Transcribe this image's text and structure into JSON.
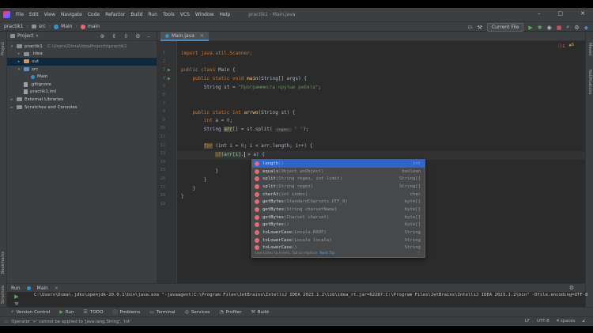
{
  "menubar": {
    "items": [
      "File",
      "Edit",
      "View",
      "Navigate",
      "Code",
      "Refactor",
      "Build",
      "Run",
      "Tools",
      "VCS",
      "Window",
      "Help"
    ],
    "title": "practik1 - Main.java"
  },
  "navbar": {
    "crumbs": [
      "practik1",
      "src",
      "Main",
      "main"
    ],
    "run_config": "Current File"
  },
  "project": {
    "header": "Project",
    "tree": [
      {
        "label": "practik1",
        "note": "C:\\Users\\Dima\\IdeaProjects\\practik1",
        "icon": "folder",
        "depth": 0,
        "arrow": "▾"
      },
      {
        "label": ".idea",
        "icon": "folder",
        "depth": 1,
        "arrow": "▸"
      },
      {
        "label": "out",
        "icon": "folder-orange",
        "depth": 1,
        "arrow": "▸",
        "selected": true
      },
      {
        "label": "src",
        "icon": "folder-blue",
        "depth": 1,
        "arrow": "▾"
      },
      {
        "label": "Main",
        "icon": "class",
        "depth": 2,
        "arrow": ""
      },
      {
        "label": ".gitignore",
        "icon": "file",
        "depth": 1,
        "arrow": ""
      },
      {
        "label": "practik1.iml",
        "icon": "file",
        "depth": 1,
        "arrow": ""
      },
      {
        "label": "External Libraries",
        "icon": "folder",
        "depth": 0,
        "arrow": "▸"
      },
      {
        "label": "Scratches and Consoles",
        "icon": "folder",
        "depth": 0,
        "arrow": "▸"
      }
    ]
  },
  "editor": {
    "tab": "Main.java",
    "warnings": "6",
    "errors": "1",
    "line_numbers": [
      "1",
      "2",
      "3",
      "4",
      "5",
      "6",
      "7",
      "8",
      "9",
      "10",
      "11",
      "12",
      "13",
      "14",
      "15",
      "16",
      "17",
      "18",
      "19"
    ],
    "lines": {
      "l1": "import java.util.Scanner;",
      "l3a": "public class ",
      "l3b": "Main {",
      "l4a": "    public static void ",
      "l4b": "main",
      "l4c": "(String[] args) {",
      "l5a": "        String st = ",
      "l5b": "\"Программисты крутые ребята\"",
      "l5c": ";",
      "l8a": "    public static int ",
      "l8b": "arrwo",
      "l8c": "(String st) {",
      "l9a": "        int ",
      "l9b": "a = ",
      "l9c": "0",
      "l9d": ";",
      "l10a": "        String ",
      "l10b": "arr",
      "l10c": "[] = st.split( ",
      "l10d": "regex:",
      "l10e": " \" \"",
      "l10f": ");",
      "l12a": "        ",
      "l12b": "for",
      "l12c": " (int i = ",
      "l12d": "0",
      "l12e": "; i < arr.length; i++) {",
      "l13a": "            ",
      "l13b": "if",
      "l13c": "(arr[i]",
      "l13d": ".",
      "l13e": " > a) {",
      "l15": "            }",
      "l16": "        }",
      "l17": "    }",
      "l18": "}"
    }
  },
  "completion": {
    "items": [
      {
        "name": "length",
        "sig": "()",
        "type": "int"
      },
      {
        "name": "equals",
        "sig": "(Object anObject)",
        "type": "boolean"
      },
      {
        "name": "split",
        "sig": "(String regex, int limit)",
        "type": "String[]"
      },
      {
        "name": "split",
        "sig": "(String regex)",
        "type": "String[]"
      },
      {
        "name": "charAt",
        "sig": "(int index)",
        "type": "char"
      },
      {
        "name": "getBytes",
        "sig": "(StandardCharsets.UTF_8)",
        "type": "byte[]"
      },
      {
        "name": "getBytes",
        "sig": "(String charsetName)",
        "type": "byte[]"
      },
      {
        "name": "getBytes",
        "sig": "(Charset charset)",
        "type": "byte[]"
      },
      {
        "name": "getBytes",
        "sig": "()",
        "type": "byte[]"
      },
      {
        "name": "toLowerCase",
        "sig": "(Locale.ROOT)",
        "type": "String"
      },
      {
        "name": "toLowerCase",
        "sig": "(Locale locale)",
        "type": "String"
      },
      {
        "name": "toLowerCase",
        "sig": "()",
        "type": "String"
      }
    ],
    "footer": "Use Enter to insert, Tab to replace",
    "footer_link": "Next Tip"
  },
  "run": {
    "label": "Run",
    "config": "Main",
    "console_line": "C:\\Users\\Dima\\.jdks\\openjdk-20.0.1\\bin\\java.exe \"-javaagent:C:\\Program Files\\JetBrains\\IntelliJ IDEA 2023.1.2\\lib\\idea_rt.jar=62287:C:\\Program Files\\JetBrains\\IntelliJ IDEA 2023.1.2\\bin\" -Dfile.encoding=UTF-8"
  },
  "bottom_tabs": [
    "Version Control",
    "Run",
    "TODO",
    "Problems",
    "Terminal",
    "Services",
    "Profiler",
    "Build"
  ],
  "status": {
    "message": "Operator '>' cannot be applied to 'java.lang.String', 'int'",
    "line_sep": "LF",
    "encoding": "UTF-8",
    "indent": "4 spaces"
  },
  "stripes": {
    "left": [
      "Project",
      "Bookmarks",
      "Structure"
    ],
    "right": [
      "Maven",
      "Notifications"
    ]
  }
}
